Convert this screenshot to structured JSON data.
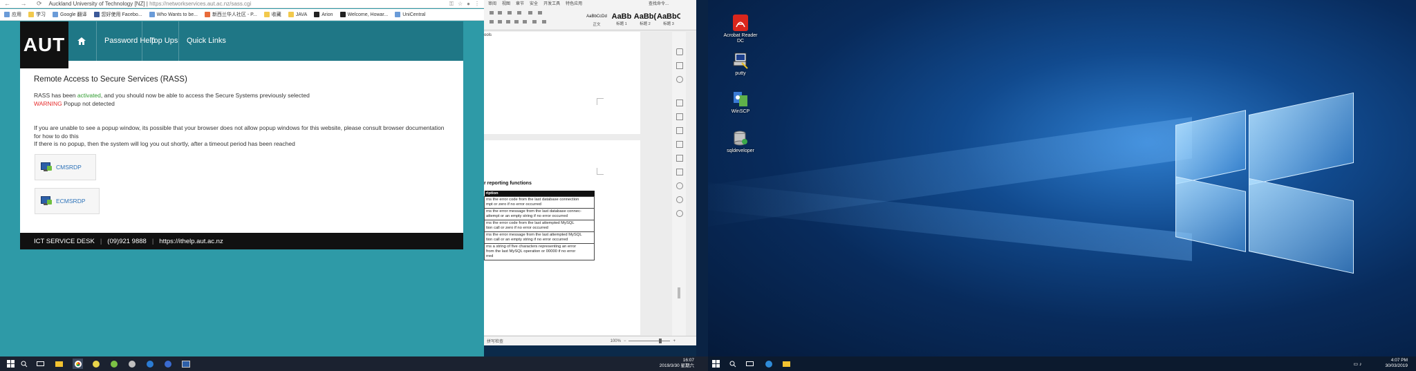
{
  "browser": {
    "address_title": "Auckland University of Technology [NZ]",
    "address_url": "https://networkservices.aut.ac.nz/sass.cgi",
    "bookmarks": [
      "应用",
      "学习",
      "Google 翻译",
      "您好使用 Facebo...",
      "Who Wants to be...",
      "新西兰华人社区 - P...",
      "收藏",
      "JAVA",
      "Arion",
      "Welcome, Howar...",
      "UniCentral"
    ]
  },
  "site": {
    "logo": "AUT",
    "nav": {
      "password_help": "Password Help",
      "top_ups": "Top Ups",
      "quick_links": "Quick Links"
    },
    "title": "Remote Access to Secure Services (RASS)",
    "line1_pre": "RASS has been ",
    "line1_activated": "activated",
    "line1_post": ", and you should now be able to access the Secure Systems previously selected",
    "warning_label": "WARNING",
    "warning_text": " Popup not detected",
    "para2_line1": "If you are unable to see a popup window, its possible that your browser does not allow popup windows for this website, please consult browser documentation",
    "para2_line2": "for how to do this",
    "para2_line3": "If there is no popup, then the system will log you out shortly, after a timeout period has been reached",
    "buttons": {
      "cmsrdp": "CMSRDP",
      "ecmsrdp": "ECMSRDP"
    },
    "footer": {
      "desk": "ICT SERVICE DESK",
      "phone": "(09)921 9888",
      "url": "https://ithelp.aut.ac.nz"
    }
  },
  "word": {
    "menu": [
      "审阅",
      "视图",
      "章节",
      "安全",
      "开发工具",
      "特色应用"
    ],
    "search": "查找命令...",
    "styles": [
      {
        "sample": "AaBbCcDd",
        "label": "正文"
      },
      {
        "sample": "AaBb",
        "label": "标题 1"
      },
      {
        "sample": "AaBb(",
        "label": "标题 2"
      },
      {
        "sample": "AaBbC",
        "label": "标题 3"
      }
    ],
    "page_top_text": "ools",
    "heading": "r reporting functions",
    "table_header": "ription",
    "table_rows": [
      "rns the error code from the last database connection\nmpt or zero if no error occurred",
      "rns the error message from the last database connec-\nattempt or an empty string if no error occurred",
      "rns the error code from the last attempted MySQL\ntion call or zero if no error occurred",
      "rns the error message from the last attempted MySQL\ntion call or an empty string if no error occurred",
      "rns a string of five characters representing an error\nfrom the last MySQL operation or 00000 if no error\nrred"
    ],
    "status_left": "拼写检查",
    "zoom": "100%"
  },
  "desktop": {
    "icons": [
      {
        "label": "Acrobat Reader DC",
        "name": "acrobat-icon"
      },
      {
        "label": "putty",
        "name": "putty-icon"
      },
      {
        "label": "WinSCP",
        "name": "winscp-icon"
      },
      {
        "label": "sqldeveloper",
        "name": "sqldeveloper-icon"
      }
    ]
  },
  "taskbar": {
    "left_clock_time": "16:07",
    "left_clock_date": "2019/3/30 星期六",
    "right_clock_time": "4:07 PM",
    "right_clock_date": "30/03/2019"
  },
  "colors": {
    "aut_teal": "#1f7786",
    "page_bg": "#2e9aa7",
    "activated": "#2e9b2e",
    "warning": "#e62b2b",
    "link": "#2b71b8"
  }
}
